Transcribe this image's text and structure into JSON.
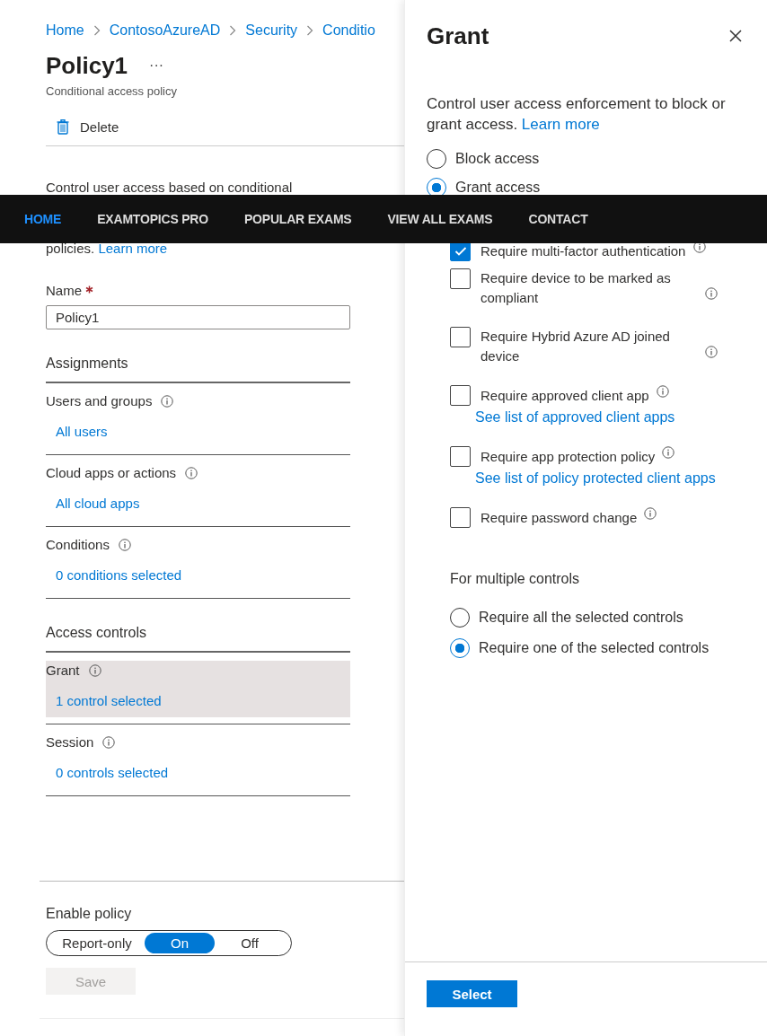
{
  "breadcrumb": [
    {
      "label": "Home"
    },
    {
      "label": "ContosoAzureAD"
    },
    {
      "label": "Security"
    },
    {
      "label": "Conditio"
    }
  ],
  "policy": {
    "title": "Policy1",
    "more": "···",
    "subtitle": "Conditional access policy"
  },
  "toolbar": [
    {
      "label": "Delete"
    }
  ],
  "description": {
    "line_1": "Control user access based on conditional",
    "line_2": "policies.",
    "link": "Learn more"
  },
  "name_field": {
    "label": "Name",
    "required": true,
    "value": "Policy1"
  },
  "sections": [
    {
      "heading": "Assignments",
      "items": [
        {
          "label": "Users and groups",
          "value": "All users",
          "selected": false
        },
        {
          "label": "Cloud apps or actions",
          "value": "All cloud apps",
          "selected": false
        },
        {
          "label": "Conditions",
          "value": "0 conditions selected",
          "selected": false
        }
      ]
    },
    {
      "heading": "Access controls",
      "items": [
        {
          "label": "Grant",
          "value": "1 control selected",
          "selected": true
        },
        {
          "label": "Session",
          "value": "0 controls selected",
          "selected": false
        }
      ]
    }
  ],
  "enable_policy": {
    "label": "Enable policy",
    "options": [
      {
        "label": "Report-only",
        "selected": false
      },
      {
        "label": "On",
        "selected": true
      },
      {
        "label": "Off",
        "selected": false
      }
    ]
  },
  "save_button": {
    "label": "Save",
    "disabled": true
  },
  "grant_panel": {
    "title": "Grant",
    "description": "Control user access enforcement to block or grant access.",
    "link": "Learn more",
    "access": [
      {
        "label": "Block access",
        "selected": false
      },
      {
        "label": "Grant access",
        "selected": true
      }
    ],
    "controls": [
      {
        "label": "Require multi-factor authentication",
        "checked": true
      },
      {
        "label": "Require device to be marked as compliant",
        "checked": false
      },
      {
        "label": "Require Hybrid Azure AD joined device",
        "checked": false
      },
      {
        "label": "Require approved client app",
        "checked": false,
        "link": "See list of approved client apps"
      },
      {
        "label": "Require app protection policy",
        "checked": false,
        "link": "See list of policy protected client apps"
      },
      {
        "label": "Require password change",
        "checked": false
      }
    ],
    "multiple_label": "For multiple controls",
    "multiple": [
      {
        "label": "Require all the selected controls",
        "selected": false
      },
      {
        "label": "Require one of the selected controls",
        "selected": true
      }
    ],
    "select_button": "Select"
  },
  "nav": [
    {
      "label": "HOME",
      "selected": true
    },
    {
      "label": "EXAMTOPICS PRO",
      "selected": false
    },
    {
      "label": "POPULAR EXAMS",
      "selected": false
    },
    {
      "label": "VIEW ALL EXAMS",
      "selected": false
    },
    {
      "label": "CONTACT",
      "selected": false
    }
  ]
}
